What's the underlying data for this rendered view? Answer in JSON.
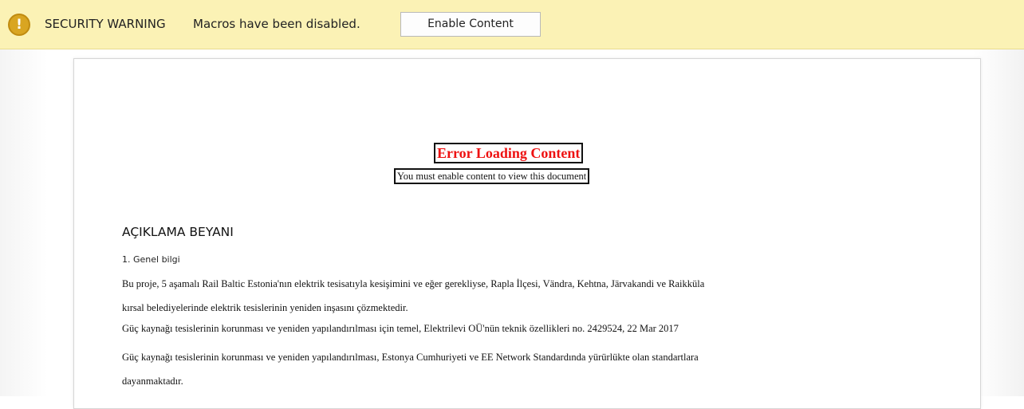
{
  "security_bar": {
    "icon": "warning-shield-icon",
    "icon_glyph": "!",
    "title": "SECURITY WARNING",
    "message": "Macros have been disabled.",
    "button_label": "Enable Content",
    "background_color": "#fbf2b5",
    "icon_color": "#d9a521"
  },
  "document": {
    "error_title": "Error Loading Content",
    "error_subtitle": "You must enable content to view this document",
    "error_color": "#ee1111",
    "heading": "AÇIKLAMA BEYANI",
    "section": "1. Genel bilgi",
    "paragraphs": [
      "Bu proje, 5 aşamalı Rail Baltic Estonia'nın elektrik tesisatıyla kesişimini ve eğer gerekliyse, Rapla İlçesi, Vändra, Kehtna, Järvakandi ve Raikküla",
      "kırsal belediyelerinde elektrik tesislerinin yeniden inşasını çözmektedir.",
      "Güç kaynağı tesislerinin korunması ve yeniden yapılandırılması için temel, Elektrilevi OÜ'nün teknik özellikleri no. 2429524, 22 Mar 2017",
      "Güç kaynağı tesislerinin korunması ve yeniden yapılandırılması, Estonya Cumhuriyeti ve EE Network Standardında yürürlükte olan standartlara",
      "dayanmaktadır."
    ]
  }
}
